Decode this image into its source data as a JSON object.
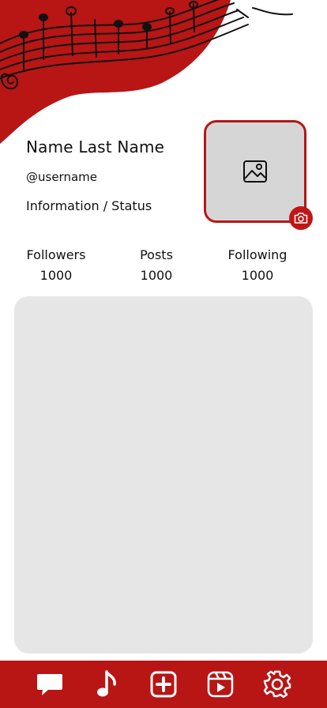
{
  "profile": {
    "name": "Name Last Name",
    "username": "@username",
    "status": "Information / Status"
  },
  "stats": {
    "followers_label": "Followers",
    "followers_value": "1000",
    "posts_label": "Posts",
    "posts_value": "1000",
    "following_label": "Following",
    "following_value": "1000"
  },
  "avatar": {
    "icon": "image-placeholder-icon",
    "badge_icon": "camera-icon"
  },
  "nav": {
    "items": [
      {
        "icon": "chat-bubble-icon"
      },
      {
        "icon": "music-note-icon"
      },
      {
        "icon": "add-square-icon"
      },
      {
        "icon": "video-reel-icon"
      },
      {
        "icon": "gear-icon"
      }
    ]
  },
  "colors": {
    "accent": "#B81515",
    "avatar_bg": "#D6D6D6",
    "panel_bg": "#E6E6E6",
    "text": "#111111",
    "background": "#FFFFFF"
  }
}
